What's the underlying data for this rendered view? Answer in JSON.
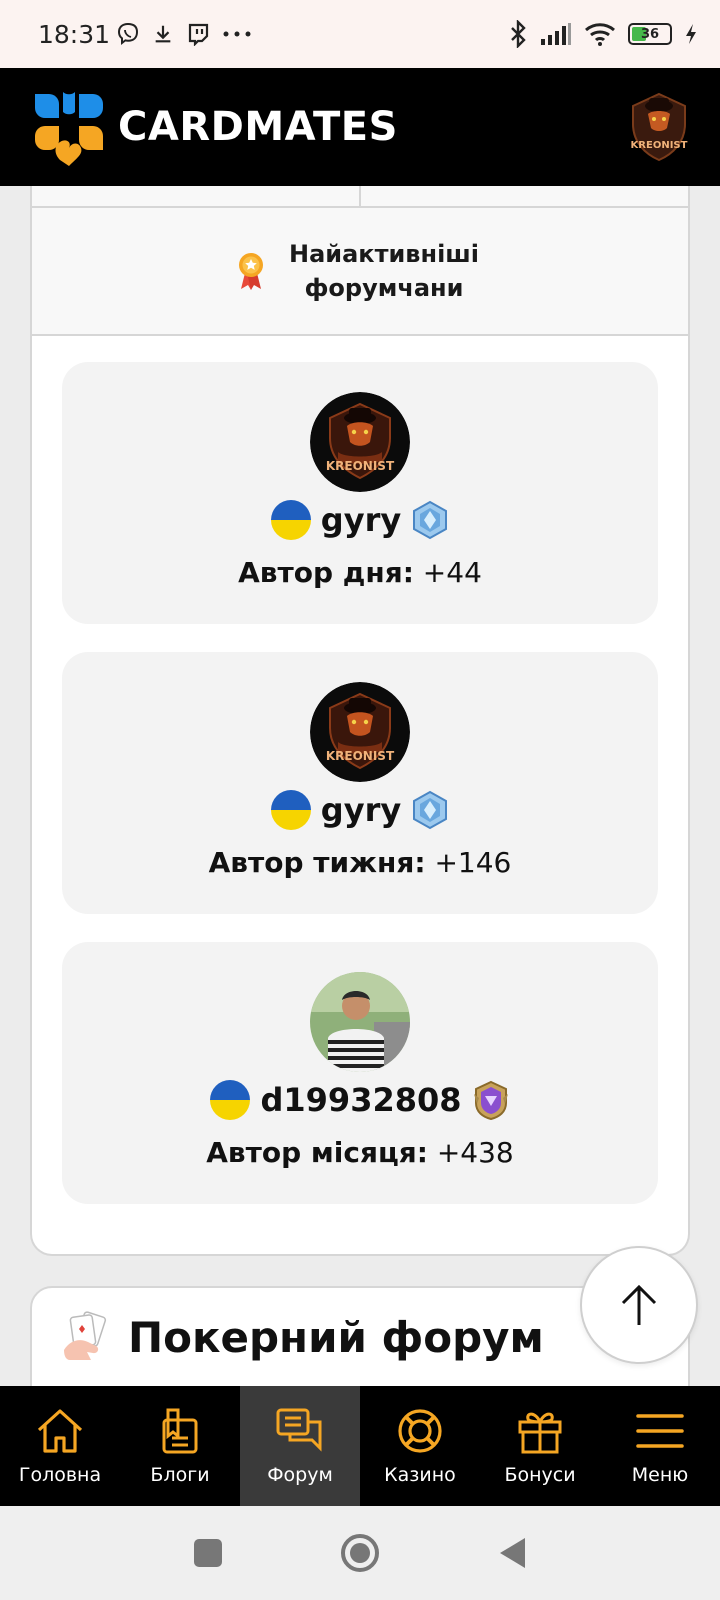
{
  "status_bar": {
    "time": "18:31",
    "battery": "36",
    "icons": [
      "viber-icon",
      "download-icon",
      "twitch-icon",
      "more-dots-icon",
      "bluetooth-icon",
      "signal-icon",
      "wifi-icon",
      "battery-icon",
      "charging-icon"
    ]
  },
  "header": {
    "brand": "CARDMATES",
    "avatar_text": "KREONIST"
  },
  "section": {
    "title": "Найактивніші форумчани",
    "icon": "medal-icon"
  },
  "authors": [
    {
      "name": "gyry",
      "avatar_text": "KREONIST",
      "label": "Автор дня:",
      "score": "+44",
      "badge": "hex-rank-icon"
    },
    {
      "name": "gyry",
      "avatar_text": "KREONIST",
      "label": "Автор тижня:",
      "score": "+146",
      "badge": "hex-rank-icon"
    },
    {
      "name": "d19932808",
      "avatar_text": "",
      "label": "Автор місяця:",
      "score": "+438",
      "badge": "purple-shield-rank-icon"
    }
  ],
  "forum_card": {
    "title": "Покерний форум",
    "icon": "cards-hand-icon"
  },
  "bottom_nav": [
    {
      "label": "Головна",
      "icon": "home-icon",
      "active": false
    },
    {
      "label": "Блоги",
      "icon": "blogs-icon",
      "active": false
    },
    {
      "label": "Форум",
      "icon": "forum-icon",
      "active": true
    },
    {
      "label": "Казино",
      "icon": "casino-icon",
      "active": false
    },
    {
      "label": "Бонуси",
      "icon": "gift-icon",
      "active": false
    },
    {
      "label": "Меню",
      "icon": "menu-icon",
      "active": false
    }
  ],
  "colors": {
    "brand_orange": "#f5a623",
    "brand_blue": "#1e8ee8",
    "header_bg": "#000000",
    "nav_active_bg": "#3a3a3a"
  }
}
